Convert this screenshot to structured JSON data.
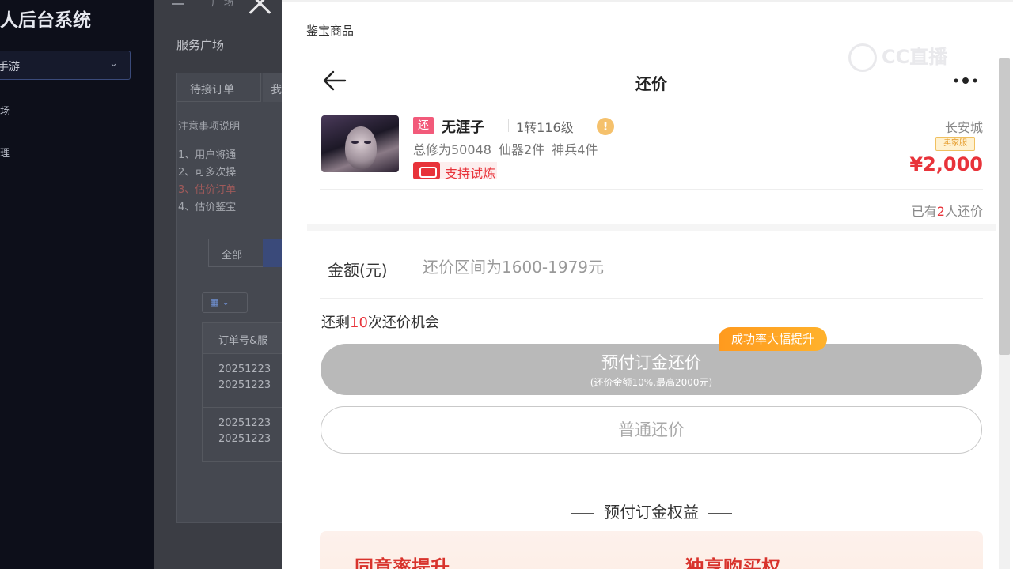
{
  "admin": {
    "brand": "人后台系统",
    "game_select": "手游",
    "menu": [
      "场",
      "理"
    ],
    "breadcrumb": "广 场",
    "page_title": "服务广场",
    "tabs": [
      "待接订单",
      "我"
    ],
    "notes_title": "注意事项说明",
    "notes": [
      "1、用户将通",
      "2、可多次操",
      "3、估价订单",
      "4、估价鉴宝"
    ],
    "filter_all": "全部",
    "grid_btn": "▦ ⌄",
    "table_header": "订单号&服",
    "rows": [
      [
        "20251223",
        "20251223"
      ],
      [
        "20251223",
        "20251223"
      ]
    ]
  },
  "drawer": {
    "title": "鉴宝商品",
    "watermark": "CC直播"
  },
  "mobile": {
    "header_title": "还价",
    "product": {
      "tag": "还",
      "name": "无涯子",
      "level": "1转116级",
      "warn_icon": "!",
      "stats": "总修为50048 仙器2件 神兵4件",
      "trial": "支持试炼",
      "server": "长安城",
      "seller_badge": "卖家服",
      "price": "¥2,000"
    },
    "bid_count_prefix": "已有",
    "bid_count_num": "2",
    "bid_count_suffix": "人还价",
    "amount_label": "金额(元)",
    "amount_placeholder": "还价区间为1600-1979元",
    "chances_prefix": "还剩",
    "chances_num": "10",
    "chances_suffix": "次还价机会",
    "promo_badge": "成功率大幅提升",
    "deposit_button": "预付订金还价",
    "deposit_sub": "(还价金额10%,最高2000元)",
    "normal_button": "普通还价",
    "benefits_title": "预付订金权益",
    "benefit_1": "同意率提升",
    "benefit_2": "独享购买权"
  }
}
